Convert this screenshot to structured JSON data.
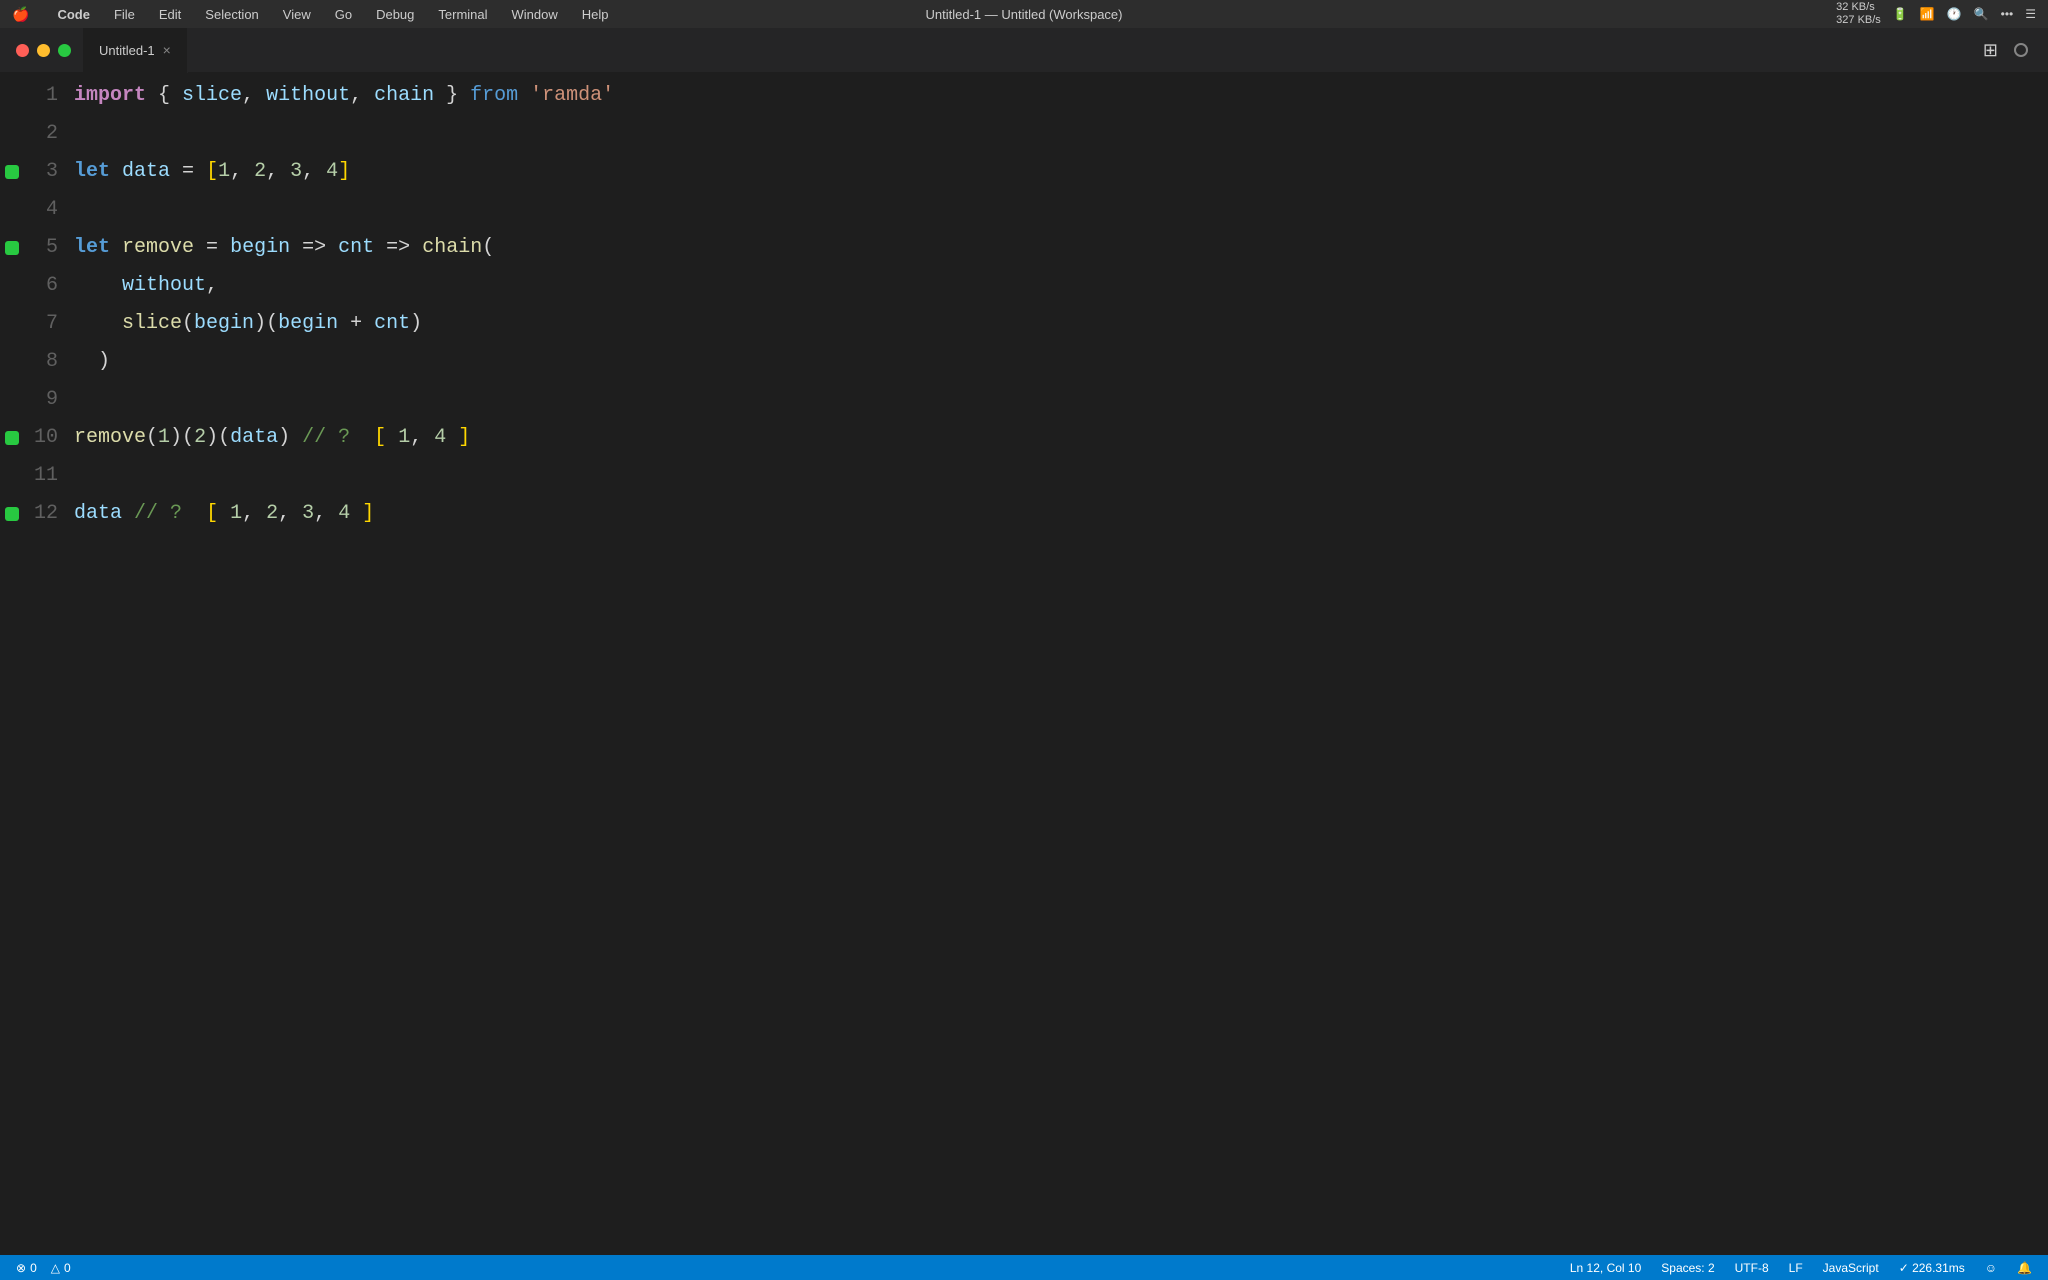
{
  "menubar": {
    "apple": "🍎",
    "items": [
      "Code",
      "File",
      "Edit",
      "Selection",
      "View",
      "Go",
      "Debug",
      "Terminal",
      "Window",
      "Help"
    ],
    "title": "Untitled-1 — Untitled (Workspace)",
    "network": "32 KB/s\n327 KB/s",
    "time": "..."
  },
  "tab": {
    "label": "Untitled-1"
  },
  "editor": {
    "lines": [
      {
        "num": 1,
        "bp": false,
        "code": "import_line"
      },
      {
        "num": 2,
        "bp": false,
        "code": "empty"
      },
      {
        "num": 3,
        "bp": true,
        "code": "data_line"
      },
      {
        "num": 4,
        "bp": false,
        "code": "empty"
      },
      {
        "num": 5,
        "bp": true,
        "code": "remove_line"
      },
      {
        "num": 6,
        "bp": false,
        "code": "without_line"
      },
      {
        "num": 7,
        "bp": false,
        "code": "slice_line"
      },
      {
        "num": 8,
        "bp": false,
        "code": "close_paren"
      },
      {
        "num": 9,
        "bp": false,
        "code": "empty"
      },
      {
        "num": 10,
        "bp": true,
        "code": "remove_call"
      },
      {
        "num": 11,
        "bp": false,
        "code": "empty"
      },
      {
        "num": 12,
        "bp": true,
        "code": "data_comment"
      }
    ]
  },
  "statusbar": {
    "errors": "0",
    "warnings": "0",
    "ln": "Ln 12, Col 10",
    "spaces": "Spaces: 2",
    "encoding": "UTF-8",
    "eol": "LF",
    "language": "JavaScript",
    "timing": "✓ 226.31ms",
    "error_icon": "⊗",
    "warning_icon": "△",
    "smiley": "☺"
  }
}
